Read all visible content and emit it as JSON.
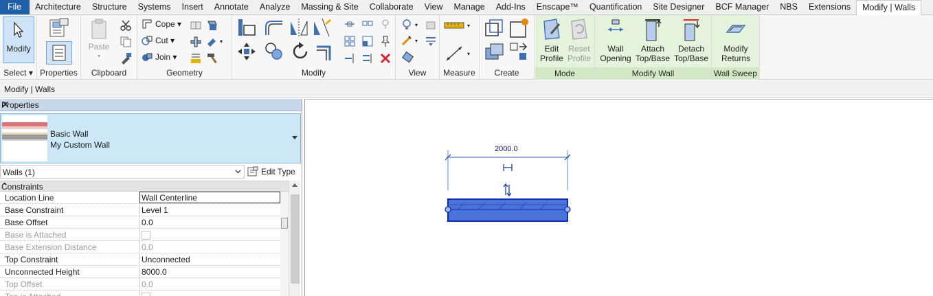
{
  "tabs": [
    "File",
    "Architecture",
    "Structure",
    "Systems",
    "Insert",
    "Annotate",
    "Analyze",
    "Massing & Site",
    "Collaborate",
    "View",
    "Manage",
    "Add-Ins",
    "Enscape™",
    "Quantification",
    "Site Designer",
    "BCF Manager",
    "NBS",
    "Extensions",
    "Modify | Walls"
  ],
  "ribbon": {
    "modify_label": "Modify",
    "select_label": "Select ▾",
    "properties_label": "Properties",
    "paste_label": "Paste",
    "clipboard_label": "Clipboard",
    "cope_label": "Cope ▾",
    "cut_label": "Cut ▾",
    "join_label": "Join ▾",
    "geometry_label": "Geometry",
    "modify_panel_label": "Modify",
    "view_label": "View",
    "measure_label": "Measure",
    "create_label": "Create",
    "edit_profile_1": "Edit",
    "edit_profile_2": "Profile",
    "reset_profile_1": "Reset",
    "reset_profile_2": "Profile",
    "mode_label": "Mode",
    "wall_opening_1": "Wall",
    "wall_opening_2": "Opening",
    "attach_1": "Attach",
    "attach_2": "Top/Base",
    "detach_1": "Detach",
    "detach_2": "Top/Base",
    "modify_wall_label": "Modify Wall",
    "modify_returns_1": "Modify",
    "modify_returns_2": "Returns",
    "wall_sweep_label": "Wall Sweep"
  },
  "optbar": {
    "text": "Modify | Walls"
  },
  "properties": {
    "title": "Properties",
    "type_family": "Basic Wall",
    "type_name": "My Custom Wall",
    "filter": "Walls (1)",
    "edit_type": "Edit Type",
    "section": "Constraints",
    "rows": [
      {
        "key": "Location Line",
        "value": "Wall Centerline"
      },
      {
        "key": "Base Constraint",
        "value": "Level 1"
      },
      {
        "key": "Base Offset",
        "value": "0.0"
      },
      {
        "key": "Base is Attached",
        "value": ""
      },
      {
        "key": "Base Extension Distance",
        "value": "0.0"
      },
      {
        "key": "Top Constraint",
        "value": "Unconnected"
      },
      {
        "key": "Unconnected Height",
        "value": "8000.0"
      },
      {
        "key": "Top Offset",
        "value": "0.0"
      },
      {
        "key": "Top is Attached",
        "value": ""
      }
    ]
  },
  "canvas": {
    "dimension": "2000.0"
  },
  "colors": {
    "file_tab": "#1f5fa8",
    "context_panel": "#e5f2dc",
    "wall_fill": "#3f6fd6",
    "selection_blue": "#1238b8"
  }
}
